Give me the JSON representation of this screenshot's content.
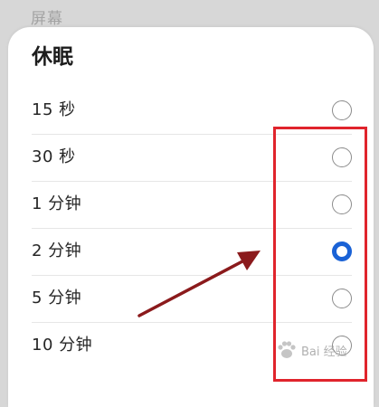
{
  "backdrop": {
    "label": "屏幕"
  },
  "sheet": {
    "title": "休眠",
    "options": [
      {
        "label": "15 秒",
        "selected": false
      },
      {
        "label": "30 秒",
        "selected": false
      },
      {
        "label": "1 分钟",
        "selected": false
      },
      {
        "label": "2 分钟",
        "selected": true
      },
      {
        "label": "5 分钟",
        "selected": false
      },
      {
        "label": "10 分钟",
        "selected": false
      }
    ]
  },
  "watermark": {
    "text": "Bai 经验",
    "icon": "paw-icon"
  },
  "colors": {
    "accent": "#1a62d6",
    "annotation_box": "#e0242c",
    "annotation_arrow": "#8b1a1c"
  }
}
